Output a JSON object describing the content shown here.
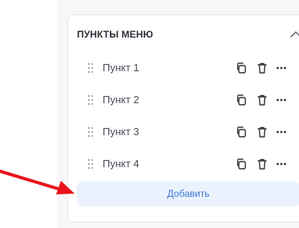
{
  "panel": {
    "title": "ПУНКТЫ МЕНЮ",
    "add_label": "Добавить"
  },
  "menu_items": [
    {
      "label": "Пункт 1"
    },
    {
      "label": "Пункт 2"
    },
    {
      "label": "Пункт 3"
    },
    {
      "label": "Пункт 4"
    }
  ],
  "icons": {
    "collapse": "chevron-up-icon",
    "drag": "drag-handle-icon",
    "copy": "copy-icon",
    "delete": "trash-icon",
    "more": "more-horizontal-icon"
  },
  "colors": {
    "accent": "#3e78d4",
    "add_bg": "#eaf2fd",
    "annotation_arrow": "#e8141a"
  }
}
